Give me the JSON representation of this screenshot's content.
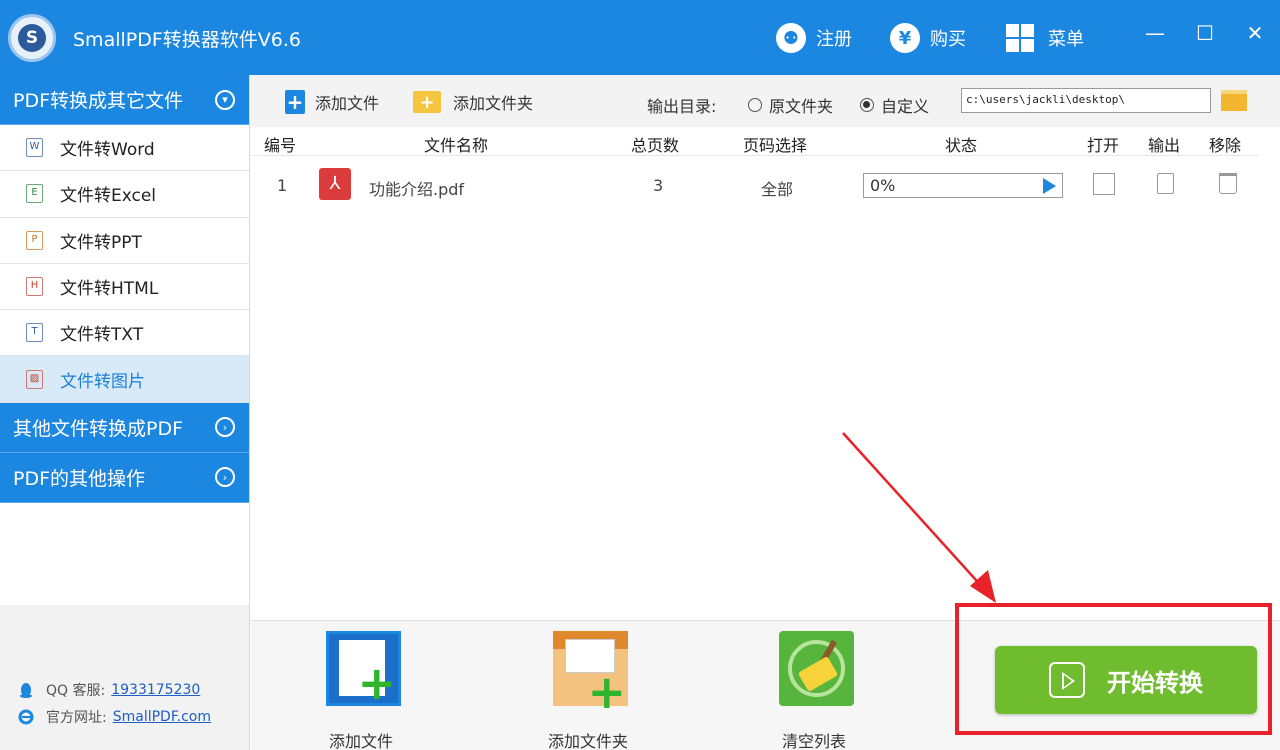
{
  "titlebar": {
    "app_title": "SmallPDF转换器软件V6.6",
    "logo_letter": "S",
    "register_label": "注册",
    "buy_label": "购买",
    "menu_label": "菜单",
    "register_icon_glyph": "⚉",
    "buy_icon_glyph": "¥",
    "minimize_glyph": "—",
    "maximize_glyph": "☐",
    "close_glyph": "✕",
    "color": "#1c87e0"
  },
  "sidebar": {
    "section_pdf_to_other": "PDF转换成其它文件",
    "section_other_to_pdf": "其他文件转换成PDF",
    "section_other_ops": "PDF的其他操作",
    "items": [
      {
        "label": "文件转Word",
        "icon_letter": "W",
        "icon_color": "#2c5fa8"
      },
      {
        "label": "文件转Excel",
        "icon_letter": "E",
        "icon_color": "#2b8a3e"
      },
      {
        "label": "文件转PPT",
        "icon_letter": "P",
        "icon_color": "#d0731c"
      },
      {
        "label": "文件转HTML",
        "icon_letter": "H",
        "icon_color": "#c0392b"
      },
      {
        "label": "文件转TXT",
        "icon_letter": "T",
        "icon_color": "#2c5fa8"
      },
      {
        "label": "文件转图片",
        "icon_letter": "▨",
        "icon_color": "#c0392b"
      }
    ],
    "footer": {
      "qq_label": "QQ 客服:",
      "qq_number": "1933175230",
      "site_label": "官方网址:",
      "site_link": "SmallPDF.com"
    }
  },
  "toolbar": {
    "add_file_label": "添加文件",
    "add_folder_label": "添加文件夹",
    "output_dir_label": "输出目录:",
    "radio_original": "原文件夹",
    "radio_custom": "自定义",
    "path_value": "c:\\users\\jackli\\desktop\\"
  },
  "table": {
    "headers": {
      "index": "编号",
      "name": "文件名称",
      "pages": "总页数",
      "range": "页码选择",
      "status": "状态",
      "open": "打开",
      "output": "输出",
      "remove": "移除"
    },
    "rows": [
      {
        "index": "1",
        "name": "功能介绍.pdf",
        "pages": "3",
        "range": "全部",
        "status": "0%"
      }
    ]
  },
  "bottom": {
    "add_file_label": "添加文件",
    "add_folder_label": "添加文件夹",
    "clear_list_label": "清空列表",
    "start_label": "开始转换"
  },
  "colors": {
    "accent": "#1c87e0",
    "start_green": "#6fbd2f",
    "highlight_red": "#e8222a"
  }
}
